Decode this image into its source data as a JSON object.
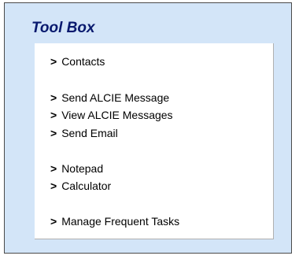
{
  "toolbox": {
    "title": "Tool Box",
    "arrow": ">",
    "links": [
      {
        "label": "Contacts"
      },
      {
        "label": "Send ALCIE Message"
      },
      {
        "label": "View ALCIE Messages"
      },
      {
        "label": "Send Email"
      },
      {
        "label": "Notepad"
      },
      {
        "label": "Calculator"
      },
      {
        "label": "Manage Frequent Tasks"
      }
    ]
  }
}
